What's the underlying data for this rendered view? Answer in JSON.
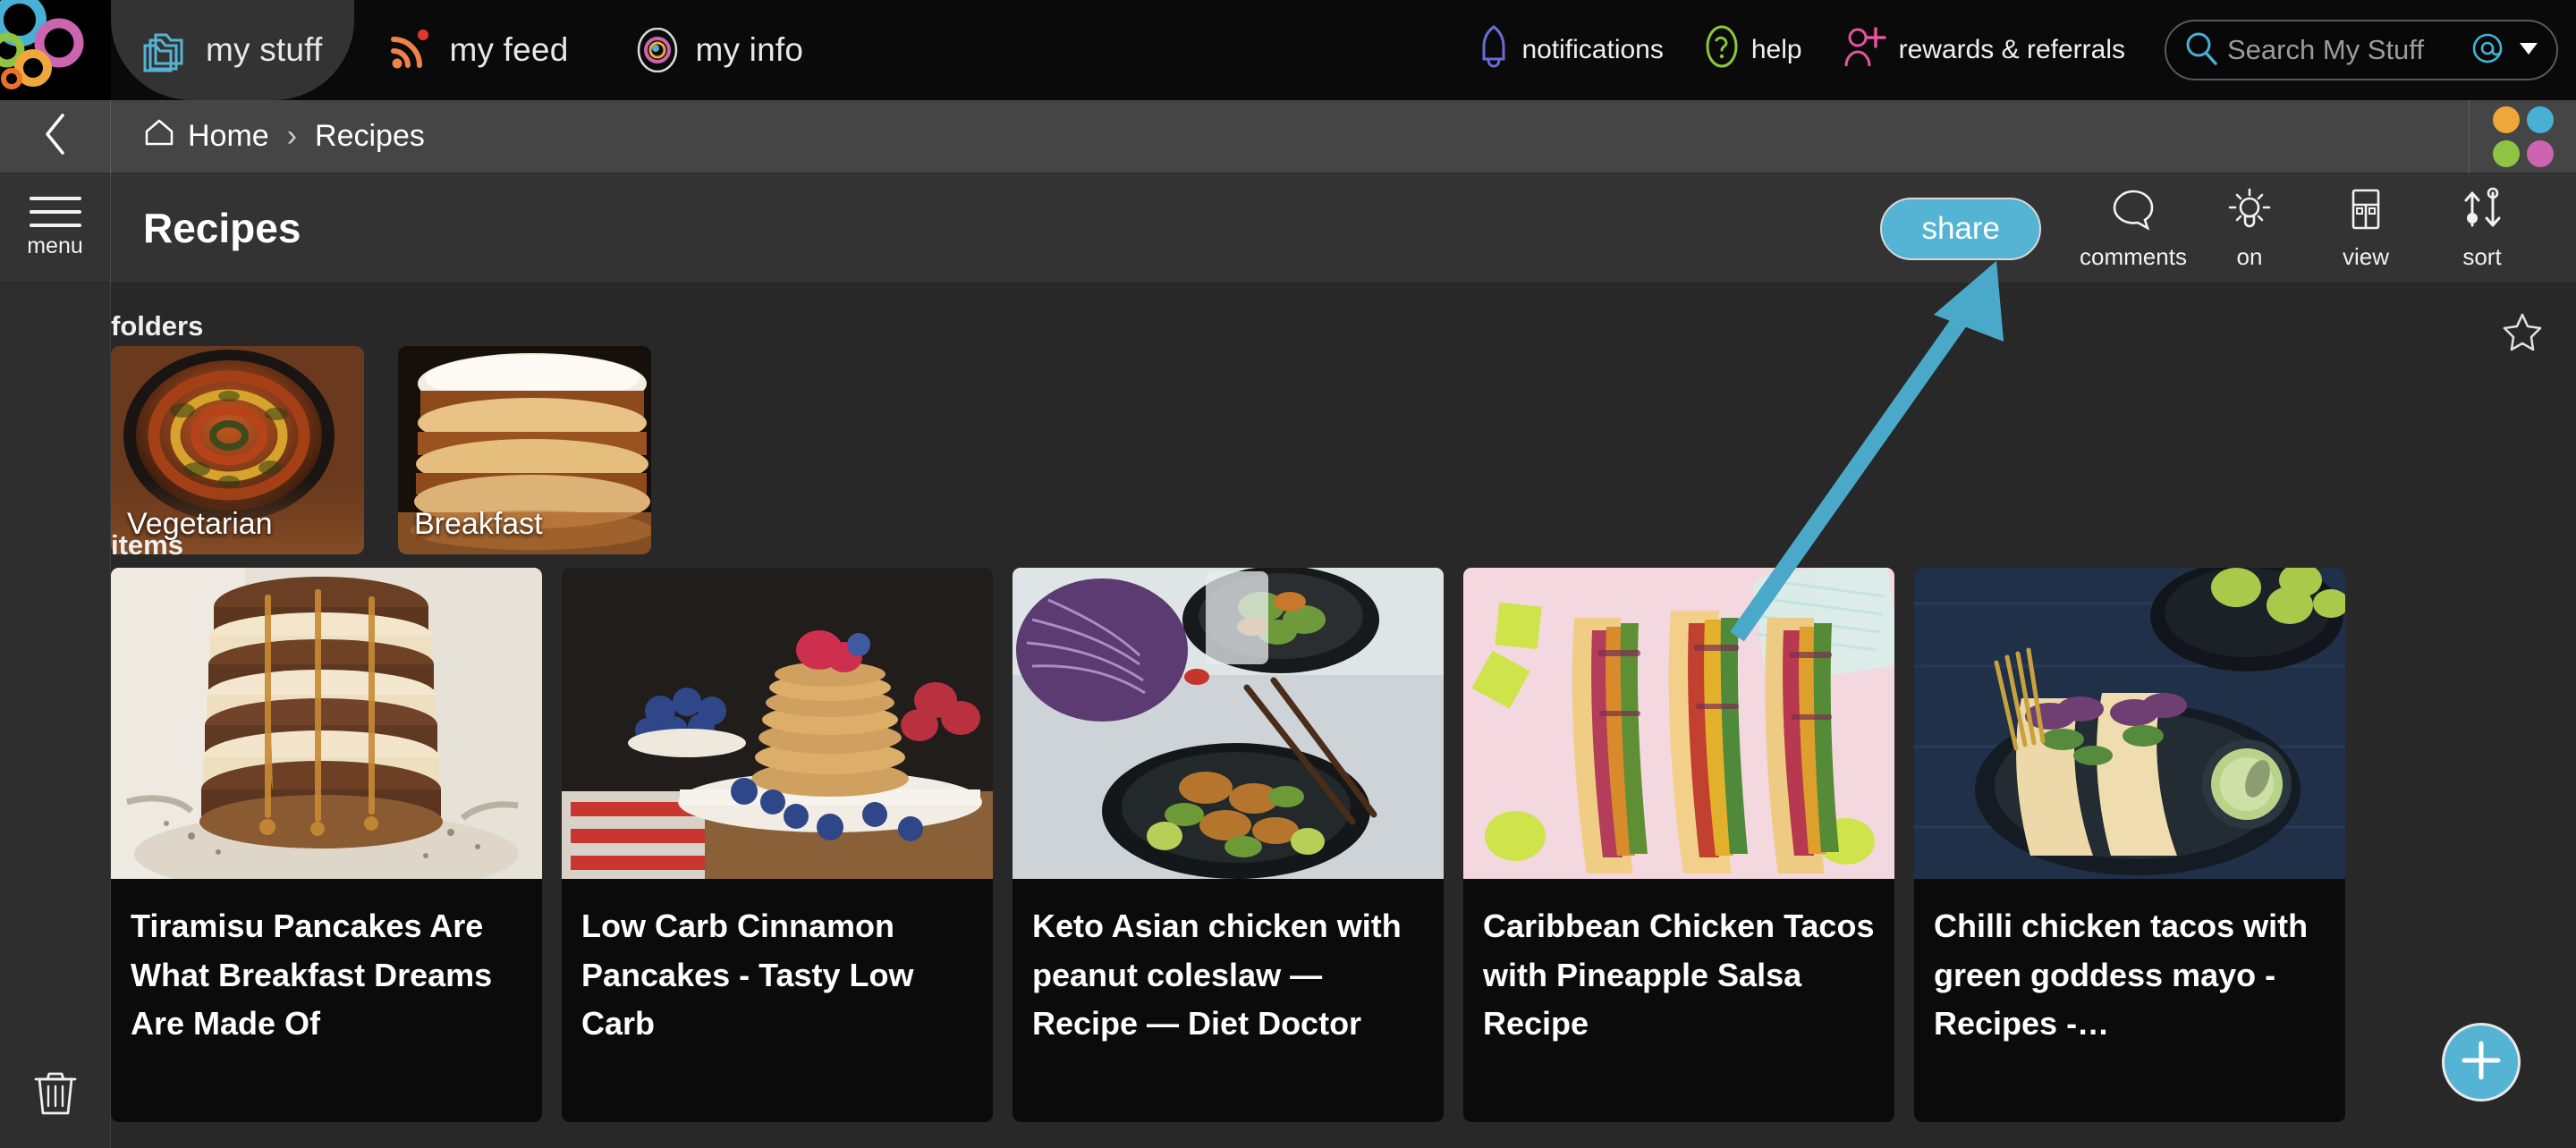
{
  "app": {
    "logo_name": "bubble-rings-logo",
    "nav_tabs": [
      {
        "label": "my stuff",
        "icon": "folders-icon",
        "active": true
      },
      {
        "label": "my feed",
        "icon": "rss-icon",
        "active": false
      },
      {
        "label": "my info",
        "icon": "profile-bubble-icon",
        "active": false
      }
    ],
    "nav_right": [
      {
        "label": "notifications",
        "icon": "bell-icon",
        "color": "#6b6bd6"
      },
      {
        "label": "help",
        "icon": "question-circle-icon",
        "color": "#8cc63f"
      },
      {
        "label": "rewards & referrals",
        "icon": "add-person-icon",
        "color": "#e2559f"
      }
    ],
    "search": {
      "placeholder": "Search My Stuff",
      "value": "",
      "at_icon": "at-icon",
      "caret_icon": "caret-down-icon"
    }
  },
  "breadcrumb": {
    "back_icon": "chevron-left-icon",
    "items": [
      {
        "label": "Home",
        "icon": "home-icon"
      },
      {
        "label": "Recipes",
        "icon": ""
      }
    ],
    "separator": "›",
    "palette_dots": [
      "#efa73b",
      "#48b0d5",
      "#8fc442",
      "#cd64b0"
    ]
  },
  "toolbar": {
    "menu_label": "menu",
    "page_title": "Recipes",
    "share_label": "share",
    "actions": [
      {
        "label": "comments",
        "icon": "comment-bubble-icon"
      },
      {
        "label": "on",
        "icon": "lightbulb-icon"
      },
      {
        "label": "view",
        "icon": "layout-grid-icon"
      },
      {
        "label": "sort",
        "icon": "sort-arrows-icon"
      }
    ]
  },
  "sidebars": {
    "trash_icon": "trash-icon",
    "star_icon": "star-outline-icon",
    "add_icon": "plus-icon"
  },
  "main": {
    "folders_label": "folders",
    "folders": [
      {
        "name": "Vegetarian",
        "thumb": "ratatouille-skillet"
      },
      {
        "name": "Breakfast",
        "thumb": "pancake-stack"
      }
    ],
    "items_label": "items",
    "items": [
      {
        "title": "Tiramisu Pancakes Are What Breakfast Dreams Are Made Of",
        "thumb": "tiramisu-pancake-stack"
      },
      {
        "title": "Low Carb Cinnamon Pancakes - Tasty Low Carb",
        "thumb": "berry-pancakes"
      },
      {
        "title": "Keto Asian chicken with peanut coleslaw — Recipe — Diet Doctor",
        "thumb": "asian-chicken-bowl"
      },
      {
        "title": "Caribbean Chicken Tacos with Pineapple Salsa Recipe",
        "thumb": "caribbean-tacos"
      },
      {
        "title": "Chilli chicken tacos with green goddess mayo - Recipes -…",
        "thumb": "chilli-chicken-tacos"
      }
    ]
  },
  "annotation": {
    "arrow_color": "#4aa8c9",
    "arrow_target": "share-button"
  }
}
